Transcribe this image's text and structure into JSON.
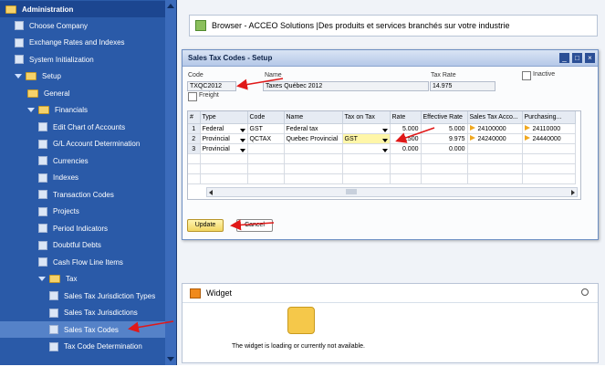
{
  "menu": {
    "header": "Administration",
    "items": [
      {
        "label": "Choose Company",
        "level": 1
      },
      {
        "label": "Exchange Rates and Indexes",
        "level": 1
      },
      {
        "label": "System Initialization",
        "level": 1
      },
      {
        "label": "Setup",
        "level": 1
      },
      {
        "label": "General",
        "level": 2
      },
      {
        "label": "Financials",
        "level": 2
      },
      {
        "label": "Edit Chart of Accounts",
        "level": 3
      },
      {
        "label": "G/L Account Determination",
        "level": 3
      },
      {
        "label": "Currencies",
        "level": 3
      },
      {
        "label": "Indexes",
        "level": 3
      },
      {
        "label": "Transaction Codes",
        "level": 3
      },
      {
        "label": "Projects",
        "level": 3
      },
      {
        "label": "Period Indicators",
        "level": 3
      },
      {
        "label": "Doubtful Debts",
        "level": 3
      },
      {
        "label": "Cash Flow Line Items",
        "level": 3
      },
      {
        "label": "Tax",
        "level": 3
      },
      {
        "label": "Sales Tax Jurisdiction Types",
        "level": 4
      },
      {
        "label": "Sales Tax Jurisdictions",
        "level": 4
      },
      {
        "label": "Sales Tax Codes",
        "level": 4
      },
      {
        "label": "Tax Code Determination",
        "level": 4
      }
    ]
  },
  "browser": {
    "title": "Browser - ACCEO Solutions |Des produits et services branchés sur votre industrie"
  },
  "dialog": {
    "title": "Sales Tax Codes - Setup",
    "code_label": "Code",
    "code_value": "TXQC2012",
    "name_label": "Name",
    "name_value": "Taxes Québec 2012",
    "taxrate_label": "Tax Rate",
    "taxrate_value": "14.975",
    "inactive_label": "Inactive",
    "freight_label": "Freight",
    "columns": [
      "#",
      "Type",
      "Code",
      "Name",
      "Tax on Tax",
      "Rate",
      "Effective Rate",
      "Sales Tax Acco...",
      "Purchasing..."
    ],
    "rows": [
      {
        "n": "1",
        "type": "Federal",
        "code": "GST",
        "name": "Federal tax",
        "taxontax": "",
        "rate": "5.000",
        "eff": "5.000",
        "sales": "24100000",
        "purch": "24110000"
      },
      {
        "n": "2",
        "type": "Provincial",
        "code": "QCTAX",
        "name": "Quebec Provincial",
        "taxontax": "GST",
        "rate": "9.500",
        "eff": "9.975",
        "sales": "24240000",
        "purch": "24440000"
      },
      {
        "n": "3",
        "type": "Provincial",
        "code": "",
        "name": "",
        "taxontax": "",
        "rate": "0.000",
        "eff": "0.000",
        "sales": "",
        "purch": ""
      }
    ],
    "update_label": "Update",
    "cancel_label": "Cancel"
  },
  "widget": {
    "title": "Widget",
    "message": "The widget is loading or currently not available."
  }
}
